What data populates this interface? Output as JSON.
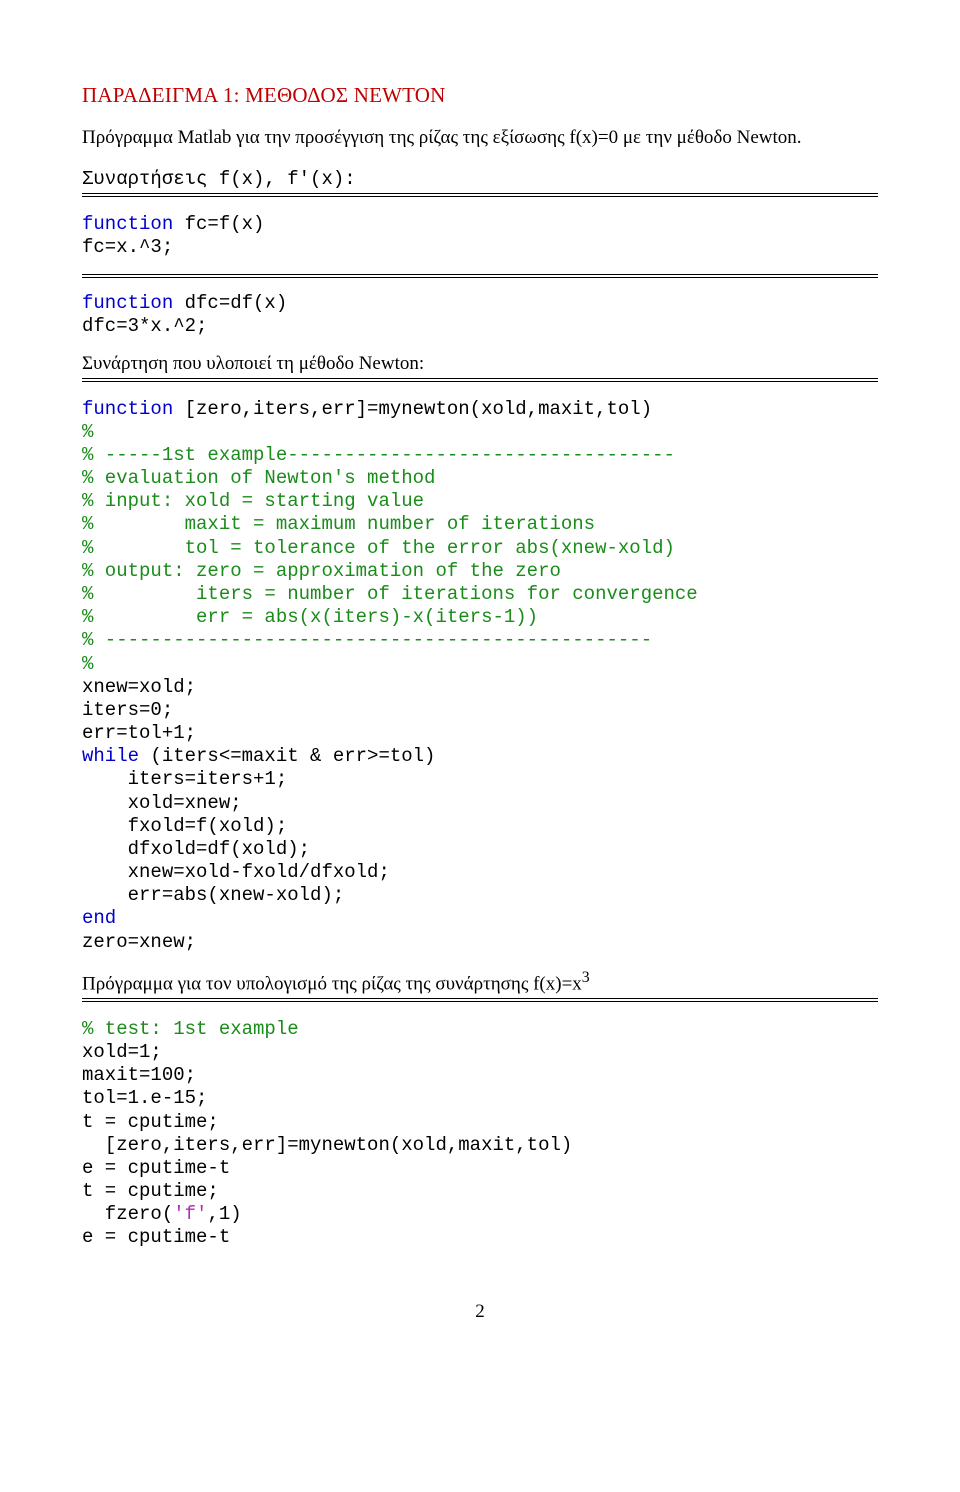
{
  "title": "ΠΑΡΑΔΕΙΓΜΑ 1: ΜΕΘΟΔΟΣ NEWTON",
  "intro": "Πρόγραμμα Matlab για την προσέγγιση της ρίζας της εξίσωσης f(x)=0 με την μέθοδο Newton.",
  "heading_functions": "Συναρτήσεις f(x), f'(x):",
  "code_f": {
    "l1": "function",
    "l1b": " fc=f(x)",
    "l2": "fc=x.^3;"
  },
  "code_df": {
    "l1": "function",
    "l1b": " dfc=df(x)",
    "l2": "dfc=3*x.^2;"
  },
  "heading_newton": "Συνάρτηση που υλοποιεί τη μέθοδο Newton:",
  "code_newton": {
    "sig_kw": "function",
    "sig_rest": " [zero,iters,err]=mynewton(xold,maxit,tol)",
    "c1": "%",
    "c2": "% -----1st example----------------------------------",
    "c3": "% evaluation of Newton's method",
    "c4": "% input: xold = starting value",
    "c5": "%        maxit = maximum number of iterations",
    "c6": "%        tol = tolerance of the error abs(xnew-xold)",
    "c7": "% output: zero = approximation of the zero",
    "c8": "%         iters = number of iterations for convergence",
    "c9": "%         err = abs(x(iters)-x(iters-1))",
    "c10": "% ------------------------------------------------",
    "c11": "%",
    "b1": "xnew=xold;",
    "b2": "iters=0;",
    "b3": "err=tol+1;",
    "b4kw": "while",
    "b4rest": " (iters<=maxit & err>=tol)",
    "b5": "    iters=iters+1;",
    "b6": "    xold=xnew;",
    "b7": "    fxold=f(xold);",
    "b8": "    dfxold=df(xold);",
    "b9": "    xnew=xold-fxold/dfxold;",
    "b10": "    err=abs(xnew-xold);",
    "b11": "end",
    "b12": "zero=xnew;"
  },
  "heading_test": "Πρόγραμμα για τον υπολογισμό της ρίζας της συνάρτησης f(x)=x",
  "heading_test_sup": "3",
  "code_test": {
    "c1": "% test: 1st example",
    "l1": "xold=1;",
    "l2": "maxit=100;",
    "l3": "tol=1.e-15;",
    "l4": "t = cputime;",
    "l5": "  [zero,iters,err]=mynewton(xold,maxit,tol)",
    "l6": "e = cputime-t",
    "l7": "t = cputime;",
    "l8a": "  fzero(",
    "l8b": "'f'",
    "l8c": ",1)",
    "l9": "e = cputime-t"
  },
  "page_number": "2"
}
